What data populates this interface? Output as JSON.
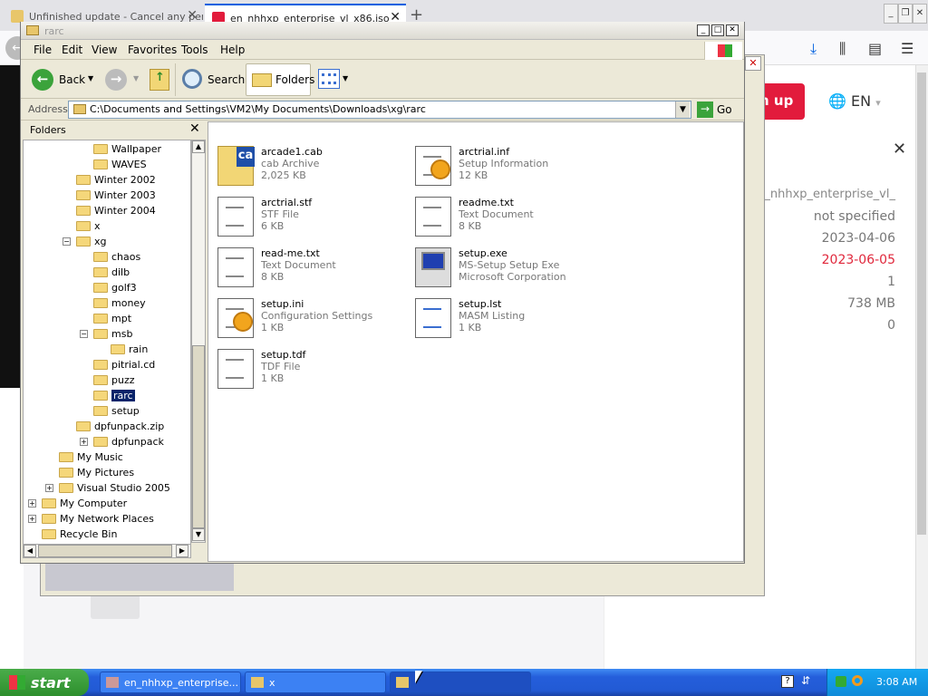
{
  "firefox": {
    "tab1_title": "Unfinished update - Cancel any pending",
    "tab2_title": "en_nhhxp_enterprise_vl_x86.iso",
    "win_minimize": "_",
    "win_restore": "❐",
    "win_close": "✕",
    "signup_label": "n up",
    "lang_label": "EN",
    "file_name": "en_nhhxp_enterprise_vl_",
    "field_values": [
      "not specified",
      "2023-04-06",
      "2023-06-05",
      "1",
      "738 MB",
      "0"
    ],
    "accent_red": "#e21b3c",
    "value_color_red": "#e0283c"
  },
  "explorer": {
    "title": "rarc",
    "menu": [
      "File",
      "Edit",
      "View",
      "Favorites",
      "Tools",
      "Help"
    ],
    "toolbar": {
      "back": "Back",
      "search": "Search",
      "folders": "Folders"
    },
    "address_label": "Address",
    "address": "C:\\Documents and Settings\\VM2\\My Documents\\Downloads\\xg\\rarc",
    "go_label": "Go",
    "folders_pane_title": "Folders",
    "tree": [
      {
        "label": "Wallpaper",
        "indent": 4
      },
      {
        "label": "WAVES",
        "indent": 4
      },
      {
        "label": "Winter 2002",
        "indent": 3
      },
      {
        "label": "Winter 2003",
        "indent": 3
      },
      {
        "label": "Winter 2004",
        "indent": 3
      },
      {
        "label": "x",
        "indent": 3
      },
      {
        "label": "xg",
        "indent": 3,
        "expander": "-"
      },
      {
        "label": "chaos",
        "indent": 4
      },
      {
        "label": "dilb",
        "indent": 4
      },
      {
        "label": "golf3",
        "indent": 4
      },
      {
        "label": "money",
        "indent": 4
      },
      {
        "label": "mpt",
        "indent": 4
      },
      {
        "label": "msb",
        "indent": 4,
        "expander": "-"
      },
      {
        "label": "rain",
        "indent": 5
      },
      {
        "label": "pitrial.cd",
        "indent": 4
      },
      {
        "label": "puzz",
        "indent": 4
      },
      {
        "label": "rarc",
        "indent": 4,
        "selected": true
      },
      {
        "label": "setup",
        "indent": 4
      },
      {
        "label": "dpfunpack.zip",
        "indent": 3
      },
      {
        "label": "dpfunpack",
        "indent": 4,
        "expander": "+"
      },
      {
        "label": "My Music",
        "indent": 2
      },
      {
        "label": "My Pictures",
        "indent": 2
      },
      {
        "label": "Visual Studio 2005",
        "indent": 2,
        "expander": "+"
      },
      {
        "label": "My Computer",
        "indent": 1,
        "expander": "+"
      },
      {
        "label": "My Network Places",
        "indent": 1,
        "expander": "+"
      },
      {
        "label": "Recycle Bin",
        "indent": 1
      }
    ],
    "files": [
      {
        "name": "arcade1.cab",
        "type": "cab Archive",
        "size": "2,025 KB",
        "icon": "cab-icon"
      },
      {
        "name": "arctrial.inf",
        "type": "Setup Information",
        "size": "12 KB",
        "icon": "setup-info-icon"
      },
      {
        "name": "arctrial.stf",
        "type": "STF File",
        "size": "6 KB",
        "icon": "stf-file-icon"
      },
      {
        "name": "readme.txt",
        "type": "Text Document",
        "size": "8 KB",
        "icon": "text-document-icon"
      },
      {
        "name": "read-me.txt",
        "type": "Text Document",
        "size": "8 KB",
        "icon": "text-document-icon"
      },
      {
        "name": "setup.exe",
        "type": "MS-Setup Setup Exe",
        "size": "Microsoft Corporation",
        "icon": "setup-exe-icon"
      },
      {
        "name": "setup.ini",
        "type": "Configuration Settings",
        "size": "1 KB",
        "icon": "config-settings-icon"
      },
      {
        "name": "setup.lst",
        "type": "MASM Listing",
        "size": "1 KB",
        "icon": "masm-listing-icon"
      },
      {
        "name": "setup.tdf",
        "type": "TDF File",
        "size": "1 KB",
        "icon": "tdf-file-icon"
      }
    ]
  },
  "taskbar": {
    "start_label": "start",
    "tasks": [
      "en_nhhxp_enterprise...",
      "x",
      ""
    ],
    "clock": "3:08 AM"
  }
}
